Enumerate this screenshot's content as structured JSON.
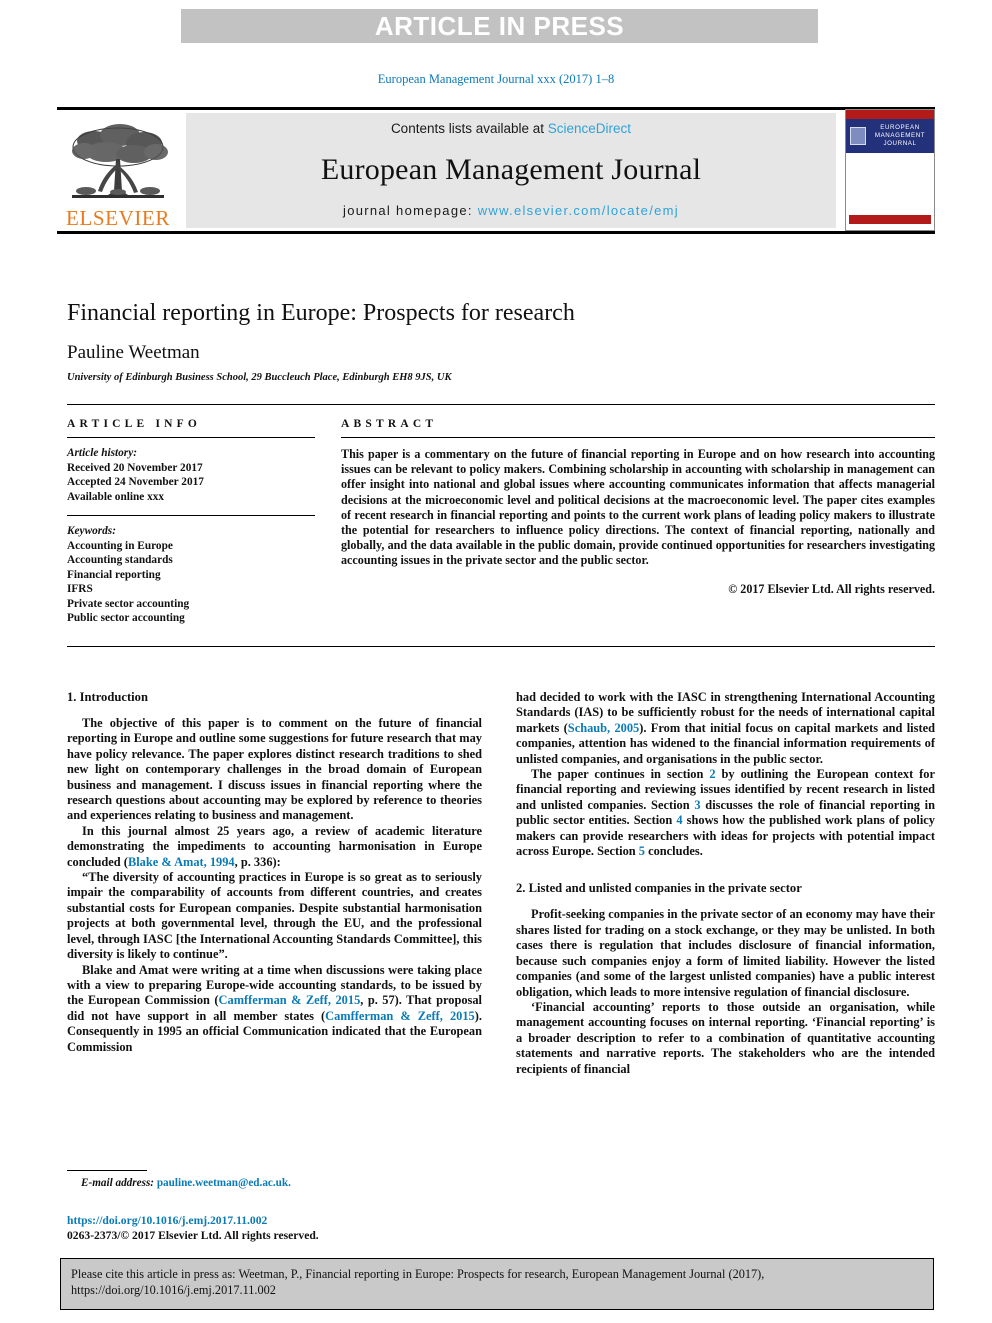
{
  "banner": {
    "text": "ARTICLE IN PRESS"
  },
  "running_head": "European Management Journal xxx (2017) 1–8",
  "masthead": {
    "contents_prefix": "Contents lists available at ",
    "sciencedirect": "ScienceDirect",
    "journal_title": "European Management Journal",
    "homepage_prefix": "journal homepage: ",
    "homepage_url": "www.elsevier.com/locate/emj",
    "publisher": "ELSEVIER",
    "cover_line1": "EUROPEAN",
    "cover_line2": "MANAGEMENT",
    "cover_line3": "JOURNAL"
  },
  "title_block": {
    "title": "Financial reporting in Europe: Prospects for research",
    "author": "Pauline Weetman",
    "affiliation": "University of Edinburgh Business School, 29 Buccleuch Place, Edinburgh EH8 9JS, UK"
  },
  "article_info": {
    "heading": "ARTICLE INFO",
    "history_label": "Article history:",
    "received": "Received 20 November 2017",
    "accepted": "Accepted 24 November 2017",
    "available": "Available online xxx",
    "keywords_label": "Keywords:",
    "keywords": [
      "Accounting in Europe",
      "Accounting standards",
      "Financial reporting",
      "IFRS",
      "Private sector accounting",
      "Public sector accounting"
    ]
  },
  "abstract": {
    "heading": "ABSTRACT",
    "text": "This paper is a commentary on the future of financial reporting in Europe and on how research into accounting issues can be relevant to policy makers. Combining scholarship in accounting with scholarship in management can offer insight into national and global issues where accounting communicates information that affects managerial decisions at the microeconomic level and political decisions at the macroeconomic level. The paper cites examples of recent research in financial reporting and points to the current work plans of leading policy makers to illustrate the potential for researchers to influence policy directions. The context of financial reporting, nationally and globally, and the data available in the public domain, provide continued opportunities for researchers investigating accounting issues in the private sector and the public sector.",
    "copyright": "© 2017 Elsevier Ltd. All rights reserved."
  },
  "body": {
    "section1_heading": "1. Introduction",
    "p1": "The objective of this paper is to comment on the future of financial reporting in Europe and outline some suggestions for future research that may have policy relevance. The paper explores distinct research traditions to shed new light on contemporary challenges in the broad domain of European business and management. I discuss issues in financial reporting where the research questions about accounting may be explored by reference to theories and experiences relating to business and management.",
    "p2_a": "In this journal almost 25 years ago, a review of academic literature demonstrating the impediments to accounting harmonisation in Europe concluded (",
    "p2_ref": "Blake & Amat, 1994",
    "p2_b": ", p. 336):",
    "p3": "“The diversity of accounting practices in Europe is so great as to seriously impair the comparability of accounts from different countries, and creates substantial costs for European companies. Despite substantial harmonisation projects at both governmental level, through the EU, and the professional level, through IASC [the International Accounting Standards Committee], this diversity is likely to continue”.",
    "p4_a": "Blake and Amat were writing at a time when discussions were taking place with a view to preparing Europe-wide accounting standards, to be issued by the European Commission (",
    "p4_ref1": "Camfferman & Zeff, 2015",
    "p4_b": ", p. 57). That proposal did not have support in all member states (",
    "p4_ref2": "Camfferman & Zeff, 2015",
    "p4_c": "). Consequently in 1995 an official Communication indicated that the European Commission",
    "p5_a": "had decided to work with the IASC in strengthening International Accounting Standards (IAS) to be sufficiently robust for the needs of international capital markets (",
    "p5_ref": "Schaub, 2005",
    "p5_b": "). From that initial focus on capital markets and listed companies, attention has widened to the financial information requirements of unlisted companies, and organisations in the public sector.",
    "p6_a": "The paper continues in section ",
    "p6_s2": "2",
    "p6_b": " by outlining the European context for financial reporting and reviewing issues identified by recent research in listed and unlisted companies. Section ",
    "p6_s3": "3",
    "p6_c": " discusses the role of financial reporting in public sector entities. Section ",
    "p6_s4": "4",
    "p6_d": " shows how the published work plans of policy makers can provide researchers with ideas for projects with potential impact across Europe. Section ",
    "p6_s5": "5",
    "p6_e": " concludes.",
    "section2_heading": "2. Listed and unlisted companies in the private sector",
    "p7": "Profit-seeking companies in the private sector of an economy may have their shares listed for trading on a stock exchange, or they may be unlisted. In both cases there is regulation that includes disclosure of financial information, because such companies enjoy a form of limited liability. However the listed companies (and some of the largest unlisted companies) have a public interest obligation, which leads to more intensive regulation of financial disclosure.",
    "p8": "‘Financial accounting’ reports to those outside an organisation, while management accounting focuses on internal reporting. ‘Financial reporting’ is a broader description to refer to a combination of quantitative accounting statements and narrative reports. The stakeholders who are the intended recipients of financial"
  },
  "footer": {
    "email_label": "E-mail address:",
    "email": "pauline.weetman@ed.ac.uk.",
    "doi": "https://doi.org/10.1016/j.emj.2017.11.002",
    "issn_line": "0263-2373/© 2017 Elsevier Ltd. All rights reserved."
  },
  "cite_box": {
    "line1": "Please cite this article in press as: Weetman, P., Financial reporting in Europe: Prospects for research, European Management Journal (2017),",
    "line2": "https://doi.org/10.1016/j.emj.2017.11.002"
  },
  "colors": {
    "link": "#0b7ab5",
    "sciencedirect": "#2ea3d8",
    "elsevier_orange": "#e87b1e",
    "banner_grey": "#c2c2c2",
    "masthead_grey": "#e6e6e6",
    "cite_grey": "#c9c9c9",
    "cover_navy": "#23307a",
    "cover_red": "#b31b1b"
  }
}
